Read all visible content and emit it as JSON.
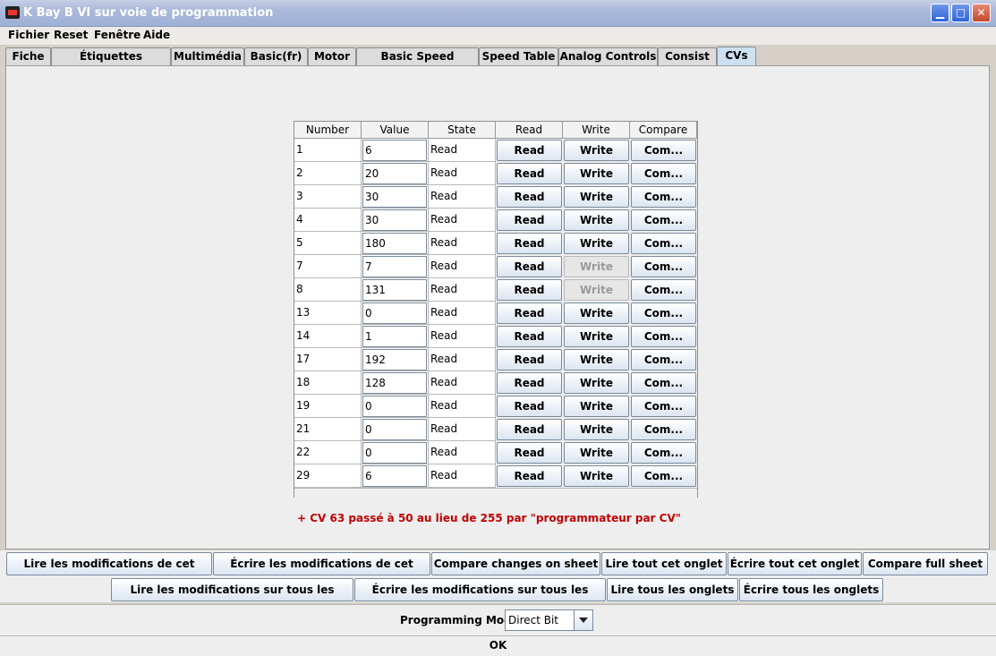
{
  "window": {
    "title": "K Bay B VI sur voie de programmation"
  },
  "menu": [
    "Fichier",
    "Reset",
    "Fenêtre",
    "Aide"
  ],
  "tabs": [
    "Fiche",
    "Étiquettes fonctions",
    "Multimédia",
    "Basic(fr)",
    "Motor",
    "Basic Speed Control",
    "Speed Table",
    "Analog Controls",
    "Consist",
    "CVs"
  ],
  "active_tab": "CVs",
  "table": {
    "headers": [
      "Number",
      "Value (Deci...",
      "State",
      "Read",
      "Write",
      "Compare"
    ],
    "rows": [
      {
        "number": "1",
        "value": "6",
        "state": "Read",
        "read": "Read",
        "write": "Write",
        "compare": "Com...",
        "write_enabled": true
      },
      {
        "number": "2",
        "value": "20",
        "state": "Read",
        "read": "Read",
        "write": "Write",
        "compare": "Com...",
        "write_enabled": true
      },
      {
        "number": "3",
        "value": "30",
        "state": "Read",
        "read": "Read",
        "write": "Write",
        "compare": "Com...",
        "write_enabled": true
      },
      {
        "number": "4",
        "value": "30",
        "state": "Read",
        "read": "Read",
        "write": "Write",
        "compare": "Com...",
        "write_enabled": true
      },
      {
        "number": "5",
        "value": "180",
        "state": "Read",
        "read": "Read",
        "write": "Write",
        "compare": "Com...",
        "write_enabled": true
      },
      {
        "number": "7",
        "value": "7",
        "state": "Read",
        "read": "Read",
        "write": "Write",
        "compare": "Com...",
        "write_enabled": false
      },
      {
        "number": "8",
        "value": "131",
        "state": "Read",
        "read": "Read",
        "write": "Write",
        "compare": "Com...",
        "write_enabled": false
      },
      {
        "number": "13",
        "value": "0",
        "state": "Read",
        "read": "Read",
        "write": "Write",
        "compare": "Com...",
        "write_enabled": true
      },
      {
        "number": "14",
        "value": "1",
        "state": "Read",
        "read": "Read",
        "write": "Write",
        "compare": "Com...",
        "write_enabled": true
      },
      {
        "number": "17",
        "value": "192",
        "state": "Read",
        "read": "Read",
        "write": "Write",
        "compare": "Com...",
        "write_enabled": true
      },
      {
        "number": "18",
        "value": "128",
        "state": "Read",
        "read": "Read",
        "write": "Write",
        "compare": "Com...",
        "write_enabled": true
      },
      {
        "number": "19",
        "value": "0",
        "state": "Read",
        "read": "Read",
        "write": "Write",
        "compare": "Com...",
        "write_enabled": true
      },
      {
        "number": "21",
        "value": "0",
        "state": "Read",
        "read": "Read",
        "write": "Write",
        "compare": "Com...",
        "write_enabled": true
      },
      {
        "number": "22",
        "value": "0",
        "state": "Read",
        "read": "Read",
        "write": "Write",
        "compare": "Com...",
        "write_enabled": true
      },
      {
        "number": "29",
        "value": "6",
        "state": "Read",
        "read": "Read",
        "write": "Write",
        "compare": "Com...",
        "write_enabled": true
      }
    ]
  },
  "note": "+ CV 63 passé à 50 au lieu de 255 par \"programmateur par CV\"",
  "actions_row1": [
    "Lire les modifications de cet onglet",
    "Écrire les modifications de cet onglet",
    "Compare changes on sheet",
    "Lire tout cet onglet",
    "Écrire tout cet onglet",
    "Compare full sheet"
  ],
  "actions_row2": [
    "Lire les modifications sur tous les onglets",
    "Écrire les modifications sur tous les onglets",
    "Lire tous les onglets",
    "Écrire tous les onglets"
  ],
  "programming_mode": {
    "label": "Programming Mode",
    "value": "Direct Bit"
  },
  "status": "OK"
}
